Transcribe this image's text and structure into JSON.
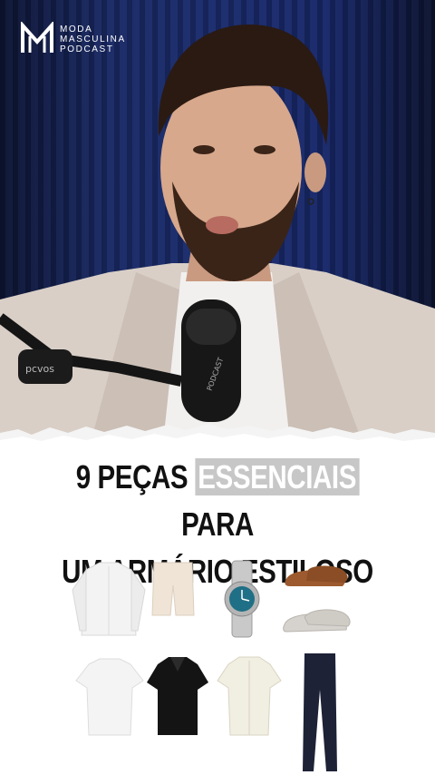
{
  "logo": {
    "line1": "MODA",
    "line2": "MASCULINA",
    "line3": "PODCAST"
  },
  "microphone": {
    "brand": "PODCAST",
    "arm_label": "pcvos"
  },
  "title": {
    "part1": "9 PEÇAS",
    "highlight": "ESSENCIAIS",
    "part2": "PARA",
    "line2": "UM ARMÁRIO ESTILOSO"
  },
  "colors": {
    "background": "#ffffff",
    "title": "#111111",
    "highlight": "#c7c7c7",
    "curtain": "#1a2a66"
  },
  "items": [
    {
      "name": "white-dress-shirt"
    },
    {
      "name": "beige-shorts"
    },
    {
      "name": "blue-dial-watch"
    },
    {
      "name": "brown-loafers"
    },
    {
      "name": "grey-sneakers"
    },
    {
      "name": "white-tshirt"
    },
    {
      "name": "black-polo"
    },
    {
      "name": "cream-camp-shirt"
    },
    {
      "name": "navy-trousers"
    }
  ]
}
